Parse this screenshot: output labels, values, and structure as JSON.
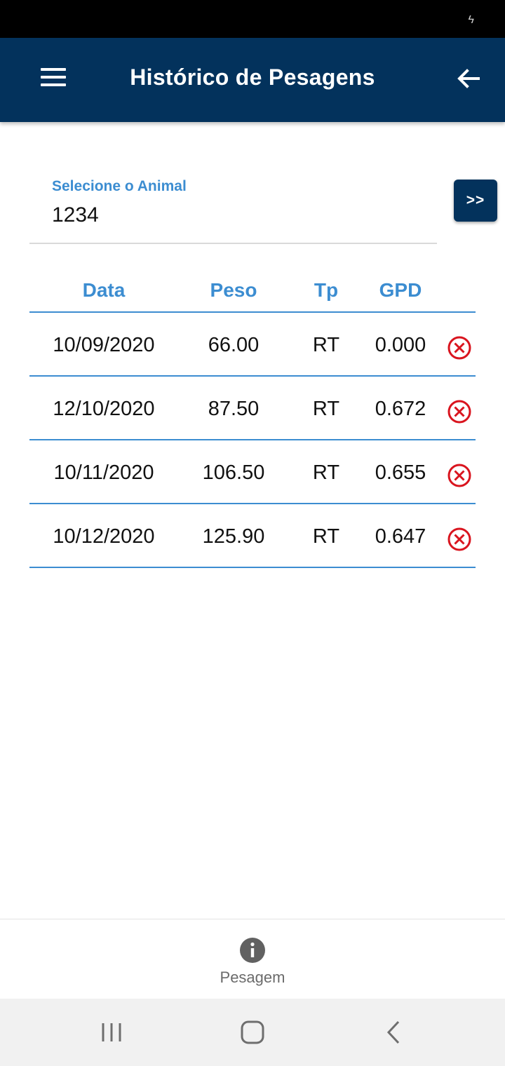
{
  "status_bar": {
    "icon": "charging-bolt-icon"
  },
  "app_bar": {
    "title": "Histórico de Pesagens",
    "bg_color": "#03325c",
    "menu_icon": "hamburger-menu-icon",
    "back_icon": "arrow-left-icon"
  },
  "animal_select": {
    "label": "Selecione o Animal",
    "value": "1234",
    "go_label": ">>"
  },
  "table": {
    "headers": [
      "Data",
      "Peso",
      "Tp",
      "GPD"
    ],
    "rows": [
      {
        "data": "10/09/2020",
        "peso": "66.00",
        "tp": "RT",
        "gpd": "0.000"
      },
      {
        "data": "12/10/2020",
        "peso": "87.50",
        "tp": "RT",
        "gpd": "0.672"
      },
      {
        "data": "10/11/2020",
        "peso": "106.50",
        "tp": "RT",
        "gpd": "0.655"
      },
      {
        "data": "10/12/2020",
        "peso": "125.90",
        "tp": "RT",
        "gpd": "0.647"
      }
    ],
    "delete_icon": "circle-x-delete-icon",
    "accent_color": "#3c8dd1",
    "delete_color": "#d9141e"
  },
  "bottom_nav": {
    "items": [
      {
        "label": "Pesagem",
        "icon": "info-icon"
      }
    ]
  },
  "system_nav": {
    "recents_icon": "recents-icon",
    "home_icon": "home-icon",
    "back_icon": "chevron-left-icon"
  }
}
